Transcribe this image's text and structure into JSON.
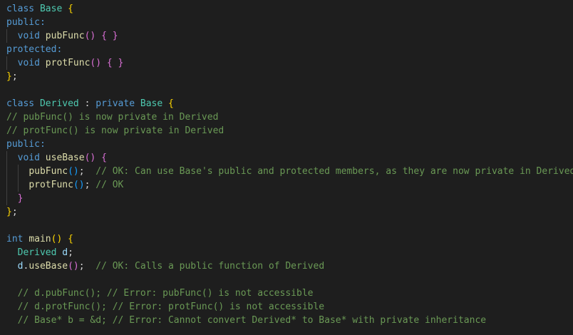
{
  "editor": {
    "lines": [
      [
        {
          "t": "class ",
          "c": "kw"
        },
        {
          "t": "Base",
          "c": "type"
        },
        {
          "t": " "
        },
        {
          "t": "{",
          "c": "b1"
        }
      ],
      [
        {
          "t": "public:",
          "c": "kw"
        }
      ],
      [
        {
          "t": "  "
        },
        {
          "t": "void",
          "c": "kw"
        },
        {
          "t": " "
        },
        {
          "t": "pubFunc",
          "c": "fn"
        },
        {
          "t": "()",
          "c": "b2"
        },
        {
          "t": " "
        },
        {
          "t": "{ }",
          "c": "b2"
        }
      ],
      [
        {
          "t": "protected:",
          "c": "kw"
        }
      ],
      [
        {
          "t": "  "
        },
        {
          "t": "void",
          "c": "kw"
        },
        {
          "t": " "
        },
        {
          "t": "protFunc",
          "c": "fn"
        },
        {
          "t": "()",
          "c": "b2"
        },
        {
          "t": " "
        },
        {
          "t": "{ }",
          "c": "b2"
        }
      ],
      [
        {
          "t": "}",
          "c": "b1"
        },
        {
          "t": ";"
        }
      ],
      [],
      [
        {
          "t": "class ",
          "c": "kw"
        },
        {
          "t": "Derived",
          "c": "type"
        },
        {
          "t": " : "
        },
        {
          "t": "private",
          "c": "kw"
        },
        {
          "t": " "
        },
        {
          "t": "Base",
          "c": "type"
        },
        {
          "t": " "
        },
        {
          "t": "{",
          "c": "b1"
        }
      ],
      [
        {
          "t": "// pubFunc() is now private in Derived",
          "c": "cm"
        }
      ],
      [
        {
          "t": "// protFunc() is now private in Derived",
          "c": "cm"
        }
      ],
      [
        {
          "t": "public:",
          "c": "kw"
        }
      ],
      [
        {
          "t": "  "
        },
        {
          "t": "void",
          "c": "kw"
        },
        {
          "t": " "
        },
        {
          "t": "useBase",
          "c": "fn"
        },
        {
          "t": "()",
          "c": "b2"
        },
        {
          "t": " "
        },
        {
          "t": "{",
          "c": "b2"
        }
      ],
      [
        {
          "t": "    "
        },
        {
          "t": "pubFunc",
          "c": "fn"
        },
        {
          "t": "()",
          "c": "b3"
        },
        {
          "t": ";  "
        },
        {
          "t": "// OK: Can use Base's public and protected members, as they are now private in Derived",
          "c": "cm"
        }
      ],
      [
        {
          "t": "    "
        },
        {
          "t": "protFunc",
          "c": "fn"
        },
        {
          "t": "()",
          "c": "b3"
        },
        {
          "t": "; "
        },
        {
          "t": "// OK",
          "c": "cm"
        }
      ],
      [
        {
          "t": "  "
        },
        {
          "t": "}",
          "c": "b2"
        }
      ],
      [
        {
          "t": "}",
          "c": "b1"
        },
        {
          "t": ";"
        }
      ],
      [],
      [
        {
          "t": "int",
          "c": "kw"
        },
        {
          "t": " "
        },
        {
          "t": "main",
          "c": "fn"
        },
        {
          "t": "()",
          "c": "b1"
        },
        {
          "t": " "
        },
        {
          "t": "{",
          "c": "b1"
        }
      ],
      [
        {
          "t": "  "
        },
        {
          "t": "Derived",
          "c": "type"
        },
        {
          "t": " "
        },
        {
          "t": "d",
          "c": "var"
        },
        {
          "t": ";"
        }
      ],
      [
        {
          "t": "  "
        },
        {
          "t": "d",
          "c": "var"
        },
        {
          "t": "."
        },
        {
          "t": "useBase",
          "c": "fn"
        },
        {
          "t": "()",
          "c": "b2"
        },
        {
          "t": ";  "
        },
        {
          "t": "// OK: Calls a public function of Derived",
          "c": "cm"
        }
      ],
      [],
      [
        {
          "t": "  "
        },
        {
          "t": "// d.pubFunc(); // Error: pubFunc() is not accessible",
          "c": "cm"
        }
      ],
      [
        {
          "t": "  "
        },
        {
          "t": "// d.protFunc(); // Error: protFunc() is not accessible",
          "c": "cm"
        }
      ],
      [
        {
          "t": "  "
        },
        {
          "t": "// Base* b = &d; // Error: Cannot convert Derived* to Base* with private inheritance",
          "c": "cm"
        }
      ]
    ]
  },
  "colors": {
    "background": "#1e1e1e",
    "keyword": "#569cd6",
    "type": "#4ec9b0",
    "function": "#dcdcaa",
    "variable": "#9cdcfe",
    "comment": "#6a9955",
    "bracket_level_1": "#ffd700",
    "bracket_level_2": "#da70d6",
    "bracket_level_3": "#179fff"
  }
}
